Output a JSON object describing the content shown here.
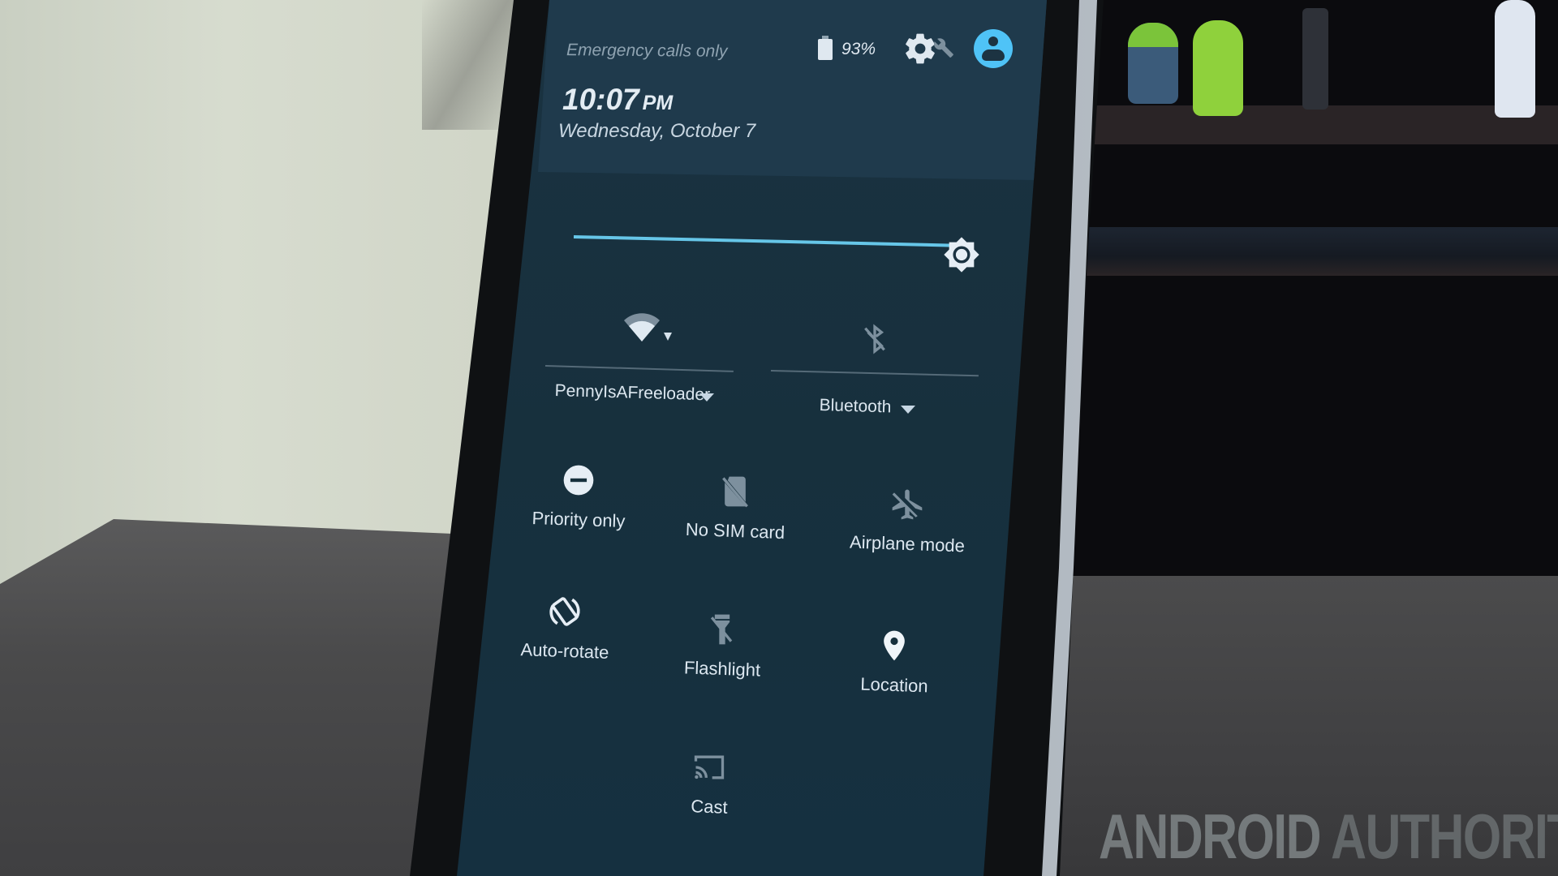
{
  "status_bar": {
    "carrier_text": "Emergency calls only",
    "battery_percent": "93%",
    "battery_icon": "battery-icon",
    "settings_icon": "gear-icon",
    "developer_icon": "wrench-icon",
    "user_icon": "account-circle-icon"
  },
  "clock": {
    "time": "10:07",
    "ampm": "PM",
    "date": "Wednesday, October 7"
  },
  "brightness": {
    "level_fraction": 1.0,
    "icon": "brightness-icon"
  },
  "wifi": {
    "icon": "wifi-icon",
    "network_name": "PennyIsAFreeloader",
    "state": "on"
  },
  "bluetooth": {
    "icon": "bluetooth-disabled-icon",
    "label": "Bluetooth",
    "state": "off"
  },
  "tiles": [
    {
      "label": "Priority only",
      "icon": "do-not-disturb-icon",
      "state": "on"
    },
    {
      "label": "No SIM card",
      "icon": "no-sim-icon",
      "state": "off"
    },
    {
      "label": "Airplane mode",
      "icon": "airplane-off-icon",
      "state": "off"
    },
    {
      "label": "Auto-rotate",
      "icon": "screen-rotation-icon",
      "state": "on"
    },
    {
      "label": "Flashlight",
      "icon": "flashlight-off-icon",
      "state": "off"
    },
    {
      "label": "Location",
      "icon": "location-pin-icon",
      "state": "on"
    },
    {
      "label": "Cast",
      "icon": "cast-icon",
      "state": "off"
    }
  ],
  "colors": {
    "accent": "#66c6e8",
    "avatar": "#4fc3f7",
    "panel_background": "#17303d",
    "header_background": "#1f3a4c",
    "text_primary": "#dce7f0",
    "text_secondary": "#8fa3b1",
    "icon_disabled": "#7d909e"
  },
  "watermark": {
    "part1": "ANDROID",
    "part2": "AUTHORITY"
  }
}
